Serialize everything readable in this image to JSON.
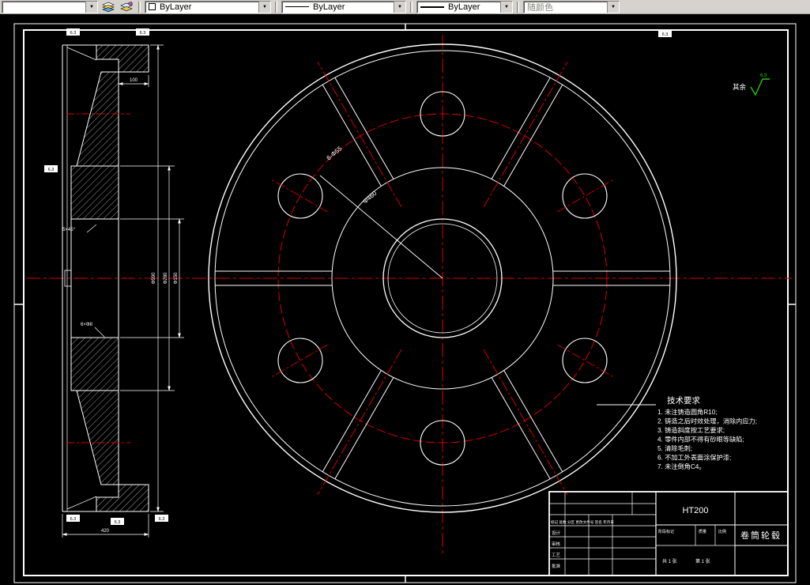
{
  "toolbar": {
    "layer_value": "",
    "color_value": "ByLayer",
    "linetype_value": "ByLayer",
    "lineweight_value": "ByLayer",
    "plotstyle_value": "随颜色",
    "icons": {
      "layer_combo_arrow": "chevron-down-icon",
      "layers_button": "layers-stack-icon",
      "layer_previous_button": "layer-previous-icon"
    }
  },
  "colors": {
    "centerline_red": "#d40000",
    "line_white": "#ffffff",
    "finish_green": "#22cc00",
    "toolbar_bg": "#d6d3ce",
    "canvas_bg": "#000000"
  },
  "tech": {
    "title": "技术要求",
    "items": [
      "1. 未注铸造圆角R10;",
      "2. 铸造之后时效处理，消除内应力;",
      "3. 铸造斜度按工艺要求;",
      "4. 零件内部不得有砂眼等缺陷;",
      "5. 清除毛刺;",
      "6. 不加工外表面涂保护漆;",
      "7. 未注倒角C4。"
    ]
  },
  "dims": {
    "bolt_circle": "Φ460",
    "holes": "6-Φ55",
    "top_width": "100",
    "chamfer": "5×45°",
    "tap_holes": "6×Φ8",
    "outer_dia": "Φ590",
    "hub_dia": "Φ280",
    "bore_dia": "Φ150",
    "total_width": "420"
  },
  "finish": {
    "rest_label": "其余",
    "value": "6.3"
  },
  "title_block": {
    "material": "HT200",
    "part_name": "卷筒轮毂",
    "revision_header": "标记 处数 分区 更改文件号 签名 年月日",
    "labels": [
      "设计",
      "审核",
      "工艺",
      "批准"
    ],
    "stage_label": "阶段标记",
    "weight_label": "质量",
    "scale_label": "比例",
    "sheet": "共 1 张",
    "page": "第 1 张"
  }
}
